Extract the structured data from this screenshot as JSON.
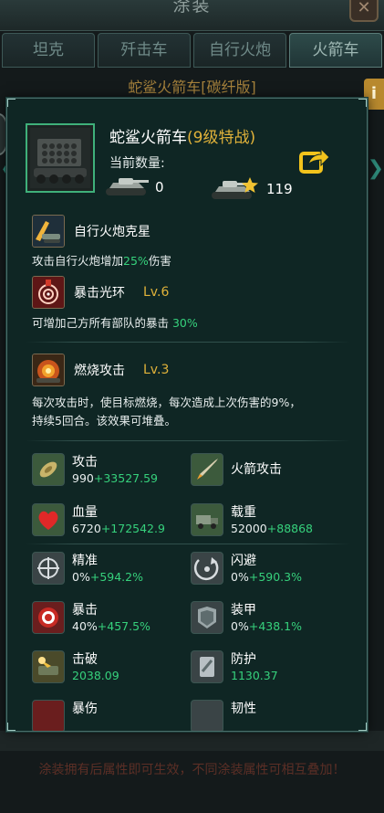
{
  "background": {
    "header_title": "涂装",
    "tabs": [
      {
        "label": "坦克",
        "active": false
      },
      {
        "label": "歼击车",
        "active": false
      },
      {
        "label": "自行火炮",
        "active": false
      },
      {
        "label": "火箭车",
        "active": true
      }
    ],
    "subtitle": "蛇鲨火箭车[碳纤版]",
    "info_label": "i",
    "footer_text": "涂装拥有后属性即可生效，不同涂装属性可相互叠加！"
  },
  "popup": {
    "unit": {
      "name": "蛇鲨火箭车",
      "grade": "(9级特战)",
      "count_label": "当前数量:",
      "count_normal": "0",
      "count_elite": "119"
    },
    "skills": [
      {
        "name": "自行火炮克星",
        "level": "",
        "desc_parts": [
          "攻击自行火炮增加",
          "25%",
          "伤害"
        ]
      },
      {
        "name": "暴击光环",
        "level": "Lv.6",
        "desc_parts": [
          "可增加己方所有部队的暴击 ",
          "30%",
          ""
        ]
      },
      {
        "name": "燃烧攻击",
        "level": "Lv.3",
        "desc_lines": [
          "每次攻击时，使目标燃烧，每次造成上次伤害的9%，",
          "持续5回合。该效果可堆叠。"
        ]
      }
    ],
    "stats": [
      {
        "name": "攻击",
        "base": "990",
        "bonus": "+33527.59",
        "icon": "shell-icon"
      },
      {
        "name": "火箭攻击",
        "base": "",
        "bonus": "",
        "icon": "rocket-icon"
      },
      {
        "name": "血量",
        "base": "6720",
        "bonus": "+172542.9",
        "icon": "heart-icon"
      },
      {
        "name": "载重",
        "base": "52000",
        "bonus": "+88868",
        "icon": "truck-icon"
      },
      {
        "name": "精准",
        "base": "0%",
        "bonus": "+594.2%",
        "icon": "crosshair-icon"
      },
      {
        "name": "闪避",
        "base": "0%",
        "bonus": "+590.3%",
        "icon": "dodge-icon"
      },
      {
        "name": "暴击",
        "base": "40%",
        "bonus": "+457.5%",
        "icon": "crit-target-icon"
      },
      {
        "name": "装甲",
        "base": "0%",
        "bonus": "+438.1%",
        "icon": "armor-icon"
      },
      {
        "name": "击破",
        "base": "",
        "bonus": "2038.09",
        "icon": "break-icon"
      },
      {
        "name": "防护",
        "base": "1130.37",
        "bonus": "",
        "icon": "shield-icon"
      },
      {
        "name": "暴伤",
        "base": "",
        "bonus": "",
        "icon": "crit-damage-icon"
      },
      {
        "name": "韧性",
        "base": "",
        "bonus": "",
        "icon": "toughness-icon"
      }
    ],
    "colors": {
      "panel_bg": "#0f2624",
      "gold": "#e0b23a",
      "green": "#36d17c",
      "border": "#4a6e6a"
    }
  }
}
